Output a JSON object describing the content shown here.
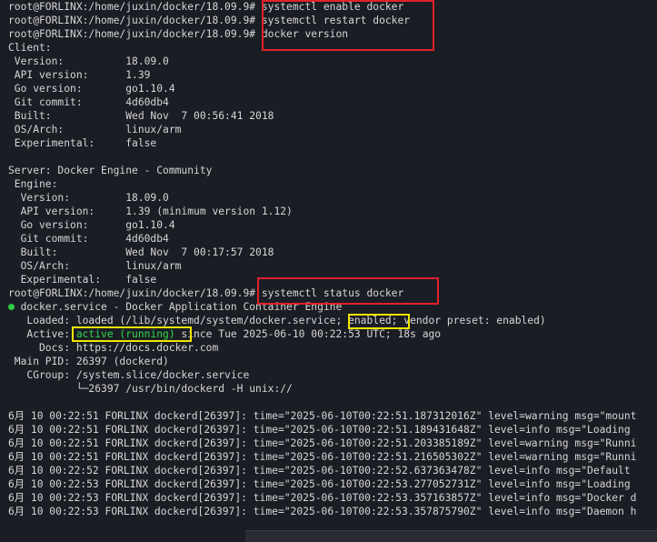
{
  "terminal": {
    "lines": [
      "root@FORLINX:/home/juxin/docker/18.09.9# systemctl enable docker",
      "root@FORLINX:/home/juxin/docker/18.09.9# systemctl restart docker",
      "root@FORLINX:/home/juxin/docker/18.09.9# docker version",
      "Client:",
      " Version:          18.09.0",
      " API version:      1.39",
      " Go version:       go1.10.4",
      " Git commit:       4d60db4",
      " Built:            Wed Nov  7 00:56:41 2018",
      " OS/Arch:          linux/arm",
      " Experimental:     false",
      "",
      "Server: Docker Engine - Community",
      " Engine:",
      "  Version:         18.09.0",
      "  API version:     1.39 (minimum version 1.12)",
      "  Go version:      go1.10.4",
      "  Git commit:      4d60db4",
      "  Built:           Wed Nov  7 00:17:57 2018",
      "  OS/Arch:         linux/arm",
      "  Experimental:    false",
      "root@FORLINX:/home/juxin/docker/18.09.9# systemctl status docker",
      "  docker.service - Docker Application Container Engine",
      "   Loaded: loaded (/lib/systemd/system/docker.service; enabled; vendor preset: enabled)",
      "   Active: active (running) since Tue 2025-06-10 00:22:53 UTC; 18s ago",
      "     Docs: https://docs.docker.com",
      " Main PID: 26397 (dockerd)",
      "   CGroup: /system.slice/docker.service",
      "           └─26397 /usr/bin/dockerd -H unix://",
      "",
      "6月 10 00:22:51 FORLINX dockerd[26397]: time=\"2025-06-10T00:22:51.187312016Z\" level=warning msg=\"mount",
      "6月 10 00:22:51 FORLINX dockerd[26397]: time=\"2025-06-10T00:22:51.189431648Z\" level=info msg=\"Loading",
      "6月 10 00:22:51 FORLINX dockerd[26397]: time=\"2025-06-10T00:22:51.203385189Z\" level=warning msg=\"Runni",
      "6月 10 00:22:51 FORLINX dockerd[26397]: time=\"2025-06-10T00:22:51.216505302Z\" level=warning msg=\"Runni",
      "6月 10 00:22:52 FORLINX dockerd[26397]: time=\"2025-06-10T00:22:52.637363478Z\" level=info msg=\"Default",
      "6月 10 00:22:53 FORLINX dockerd[26397]: time=\"2025-06-10T00:22:53.277052731Z\" level=info msg=\"Loading",
      "6月 10 00:22:53 FORLINX dockerd[26397]: time=\"2025-06-10T00:22:53.357163857Z\" level=info msg=\"Docker d",
      "6月 10 00:22:53 FORLINX dockerd[26397]: time=\"2025-06-10T00:22:53.357875790Z\" level=info msg=\"Daemon h"
    ],
    "status_dot_color": "#2ecc40",
    "highlight_red": "#e0202a",
    "highlight_yellow": "#f0e600"
  }
}
